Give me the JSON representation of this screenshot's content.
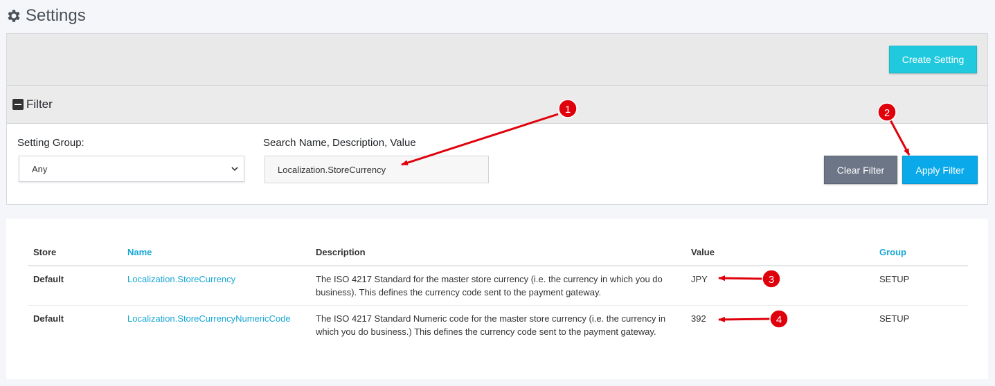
{
  "page": {
    "title": "Settings",
    "icon": "gear-icon"
  },
  "toolbar": {
    "create_label": "Create Setting"
  },
  "filter": {
    "header_label": "Filter",
    "group_label": "Setting Group:",
    "group_value": "Any",
    "search_label": "Search Name, Description, Value",
    "search_value": "Localization.StoreCurrency",
    "clear_label": "Clear Filter",
    "apply_label": "Apply Filter"
  },
  "table": {
    "headers": [
      "Store",
      "Name",
      "Description",
      "Value",
      "Group"
    ],
    "rows": [
      {
        "store": "Default",
        "name": "Localization.StoreCurrency",
        "description": "The ISO 4217 Standard for the master store currency (i.e. the currency in which you do business). This defines the currency code sent to the payment gateway.",
        "value": "JPY",
        "group": "SETUP"
      },
      {
        "store": "Default",
        "name": "Localization.StoreCurrencyNumericCode",
        "description": "The ISO 4217 Standard Numeric code for the master store currency (i.e. the currency in which you do business.) This defines the currency code sent to the payment gateway.",
        "value": "392",
        "group": "SETUP"
      }
    ]
  },
  "annotations": {
    "markers": [
      "1",
      "2",
      "3",
      "4"
    ],
    "color": "#e0000b"
  },
  "colors": {
    "accent": "#17a7d6",
    "create": "#20c9de",
    "apply": "#0aa9ea",
    "clear": "#6c7686"
  }
}
